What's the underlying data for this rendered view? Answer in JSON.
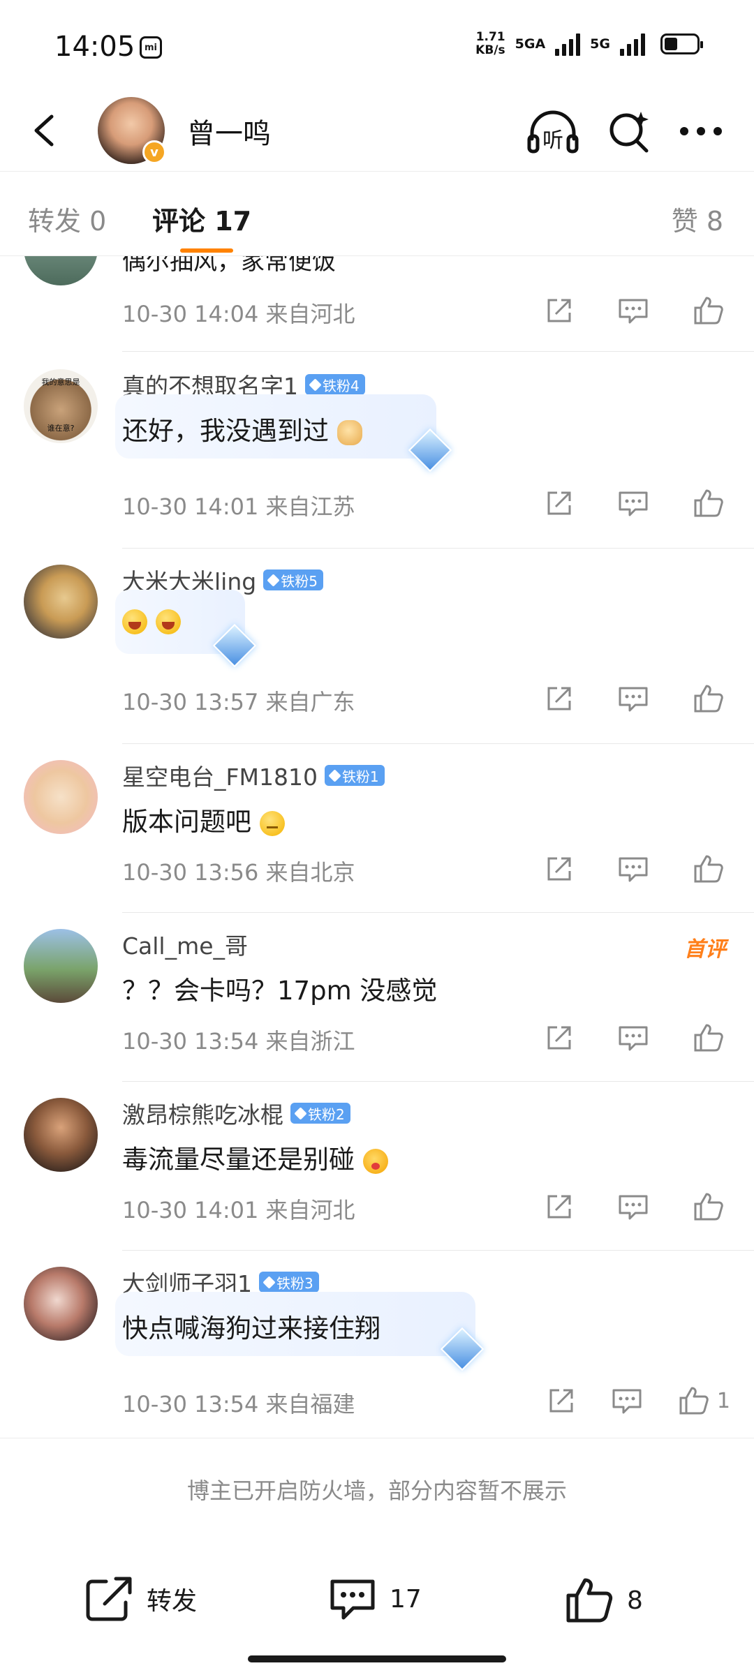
{
  "status_bar": {
    "time": "14:05",
    "speed_value": "1.71",
    "speed_unit": "KB/s",
    "network_1": "5GA",
    "network_2": "5G",
    "battery_level": 0.4
  },
  "header": {
    "title": "曾一鸣",
    "icons": [
      "back-arrow-icon",
      "listen-headphones-icon",
      "search-icon",
      "more-icon"
    ]
  },
  "tabs": {
    "repost": "转发 0",
    "comments": "评论 17",
    "likes": "赞 8"
  },
  "colors": {
    "accent": "#ff8200",
    "fan_badge": "#5aa0f2",
    "muted_text": "#8a8a8a",
    "first_comment": "#ff7f1a",
    "verified_badge": "#f5a623"
  },
  "cut_comment": {
    "text": "偶尔抽风，家常便饭",
    "time": "10-30 14:04 来自河北"
  },
  "comments": [
    {
      "name": "真的不想取名字1",
      "badge": "铁粉4",
      "text": "还好，我没遇到过",
      "emoji": "doge-emoji-icon",
      "time": "10-30 14:01 来自江苏",
      "avatar_text_top": "我的意思是",
      "avatar_text_bottom": "谁在意?"
    },
    {
      "name": "大米大米ling",
      "badge": "铁粉5",
      "text": "",
      "emoji": "laugh-emoji-icon",
      "time": "10-30 13:57 来自广东"
    },
    {
      "name": "星空电台_FM1810",
      "badge": "铁粉1",
      "text": "版本问题吧",
      "emoji": "thinking-emoji-icon",
      "time": "10-30 13:56 来自北京"
    },
    {
      "name": "Call_me_哥",
      "badge": "",
      "first_label": "首评",
      "text": "？？会卡吗？17pm 没感觉",
      "time": "10-30 13:54 来自浙江"
    },
    {
      "name": "激昂棕熊吃冰棍",
      "badge": "铁粉2",
      "text": "毒流量尽量还是别碰",
      "emoji": "tongue-emoji-icon",
      "time": "10-30 14:01 来自河北"
    },
    {
      "name": "大剑师子羽1",
      "badge": "铁粉3",
      "text": "快点喊海狗过来接住翔",
      "time": "10-30 13:54 来自福建",
      "likes": "1"
    }
  ],
  "firewall_notice": "博主已开启防火墙，部分内容暂不展示",
  "bottom_bar": {
    "repost_label": "转发",
    "comment_count": "17",
    "like_count": "8"
  }
}
